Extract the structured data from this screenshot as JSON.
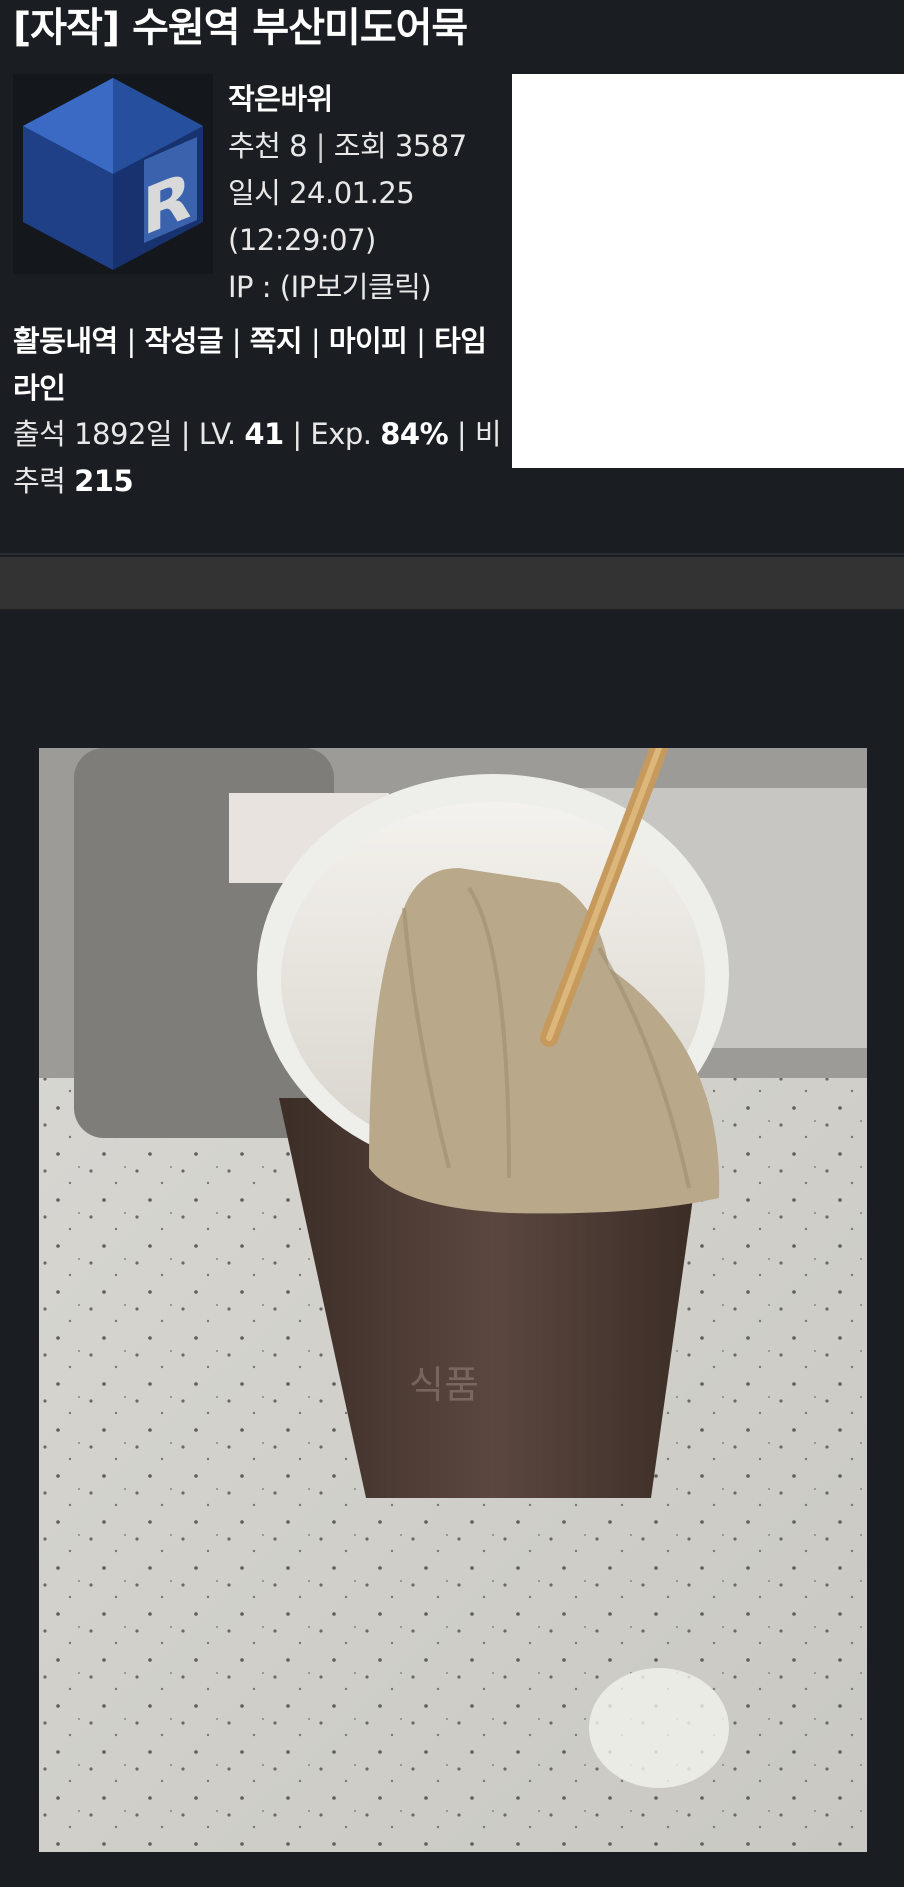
{
  "post": {
    "title": "[자작] 수원역 부산미도어묵"
  },
  "author": {
    "nickname": "작은바위",
    "avatar_letter": "R"
  },
  "meta": {
    "recommend_label": "추천",
    "recommend_count": "8",
    "views_label": "조회",
    "views_count": "3587",
    "date_label": "일시",
    "date": "24.01.25",
    "time": "(12:29:07)",
    "ip_label": "IP :",
    "ip_value": "(IP보기클릭)"
  },
  "actions": {
    "activity": "활동내역",
    "posts": "작성글",
    "message": "쪽지",
    "mypi": "마이피",
    "timeline": "타임라인"
  },
  "stats": {
    "attendance_label": "출석",
    "attendance_value": "1892일",
    "level_label": "LV.",
    "level_value": "41",
    "exp_label": "Exp.",
    "exp_value": "84%",
    "ratio_label": "비추력",
    "ratio_value": "215"
  },
  "colors": {
    "background": "#1a1d22",
    "gray_bar": "#333333",
    "avatar_blue": "#2a4f9c"
  },
  "icons": {
    "avatar": "blue-cube-r-logo"
  }
}
